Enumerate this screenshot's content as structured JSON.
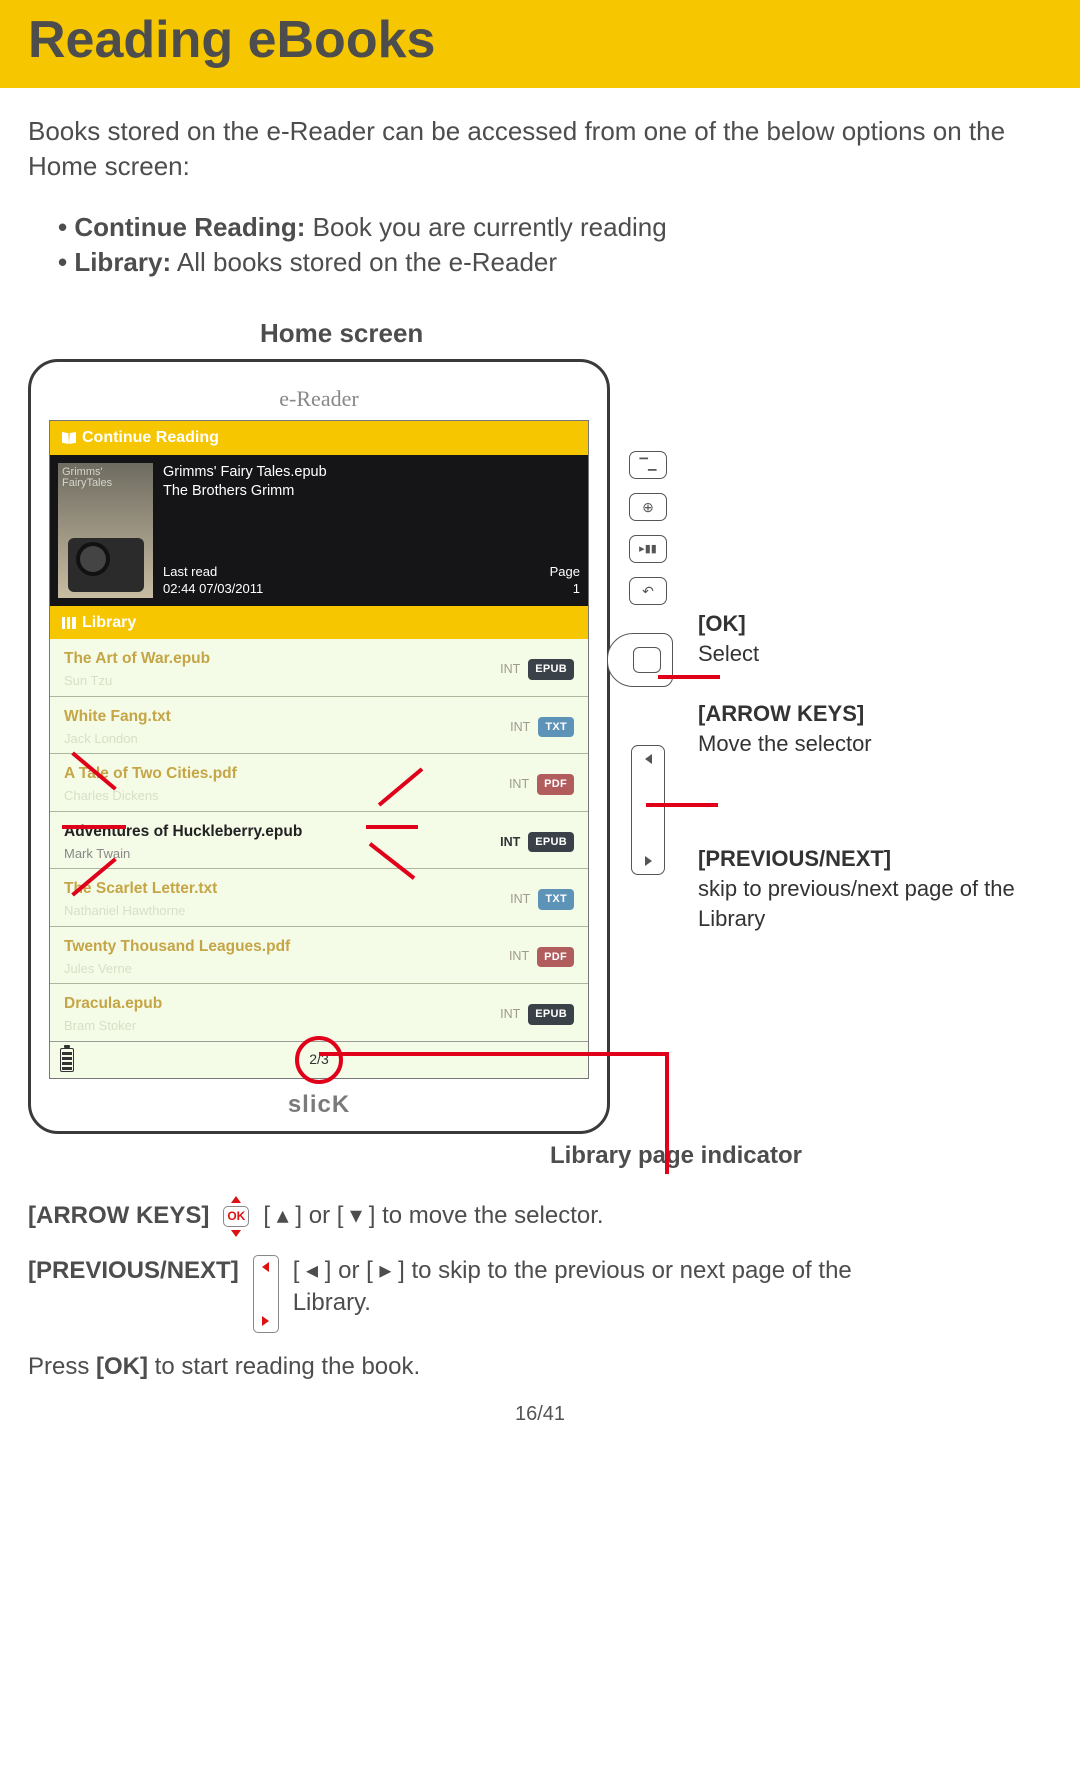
{
  "header": {
    "title": "Reading eBooks"
  },
  "intro": "Books stored on the e-Reader can be accessed from one of the below options on the Home screen:",
  "bullets": {
    "b1_label": "Continue Reading:",
    "b1_text": " Book you are currently reading",
    "b2_label": "Library:",
    "b2_text": " All books stored on the e-Reader"
  },
  "homescreen_label": "Home screen",
  "device": {
    "title": "e-Reader",
    "brand": "slicK",
    "continue_section": "Continue Reading",
    "library_section": "Library",
    "cover_title": "Grimms'\nFairyTales",
    "book_title": "Grimms' Fairy Tales.epub",
    "book_author": "The Brothers Grimm",
    "lastread_label": "Last read",
    "lastread_value": "02:44 07/03/2011",
    "page_label": "Page",
    "page_value": "1",
    "page_indicator": "2/3",
    "int_label": "INT",
    "library": [
      {
        "title": "The Art of War.epub",
        "author": "Sun Tzu",
        "fmt": "EPUB",
        "cls": "epub",
        "sel": false
      },
      {
        "title": "White Fang.txt",
        "author": "Jack London",
        "fmt": "TXT",
        "cls": "txt",
        "sel": false
      },
      {
        "title": "A Tale of Two Cities.pdf",
        "author": "Charles Dickens",
        "fmt": "PDF",
        "cls": "pdf",
        "sel": false
      },
      {
        "title": "Adventures of Huckleberry.epub",
        "author": "Mark Twain",
        "fmt": "EPUB",
        "cls": "epub",
        "sel": true
      },
      {
        "title": "The Scarlet Letter.txt",
        "author": "Nathaniel Hawthorne",
        "fmt": "TXT",
        "cls": "txt",
        "sel": false
      },
      {
        "title": "Twenty Thousand Leagues.pdf",
        "author": "Jules Verne",
        "fmt": "PDF",
        "cls": "pdf",
        "sel": false
      },
      {
        "title": "Dracula.epub",
        "author": "Bram Stoker",
        "fmt": "EPUB",
        "cls": "epub",
        "sel": false
      }
    ],
    "side_glyphs": {
      "home": "⌂",
      "zoom": "⊕",
      "play": "▸▮▮",
      "back": "↶"
    }
  },
  "callouts": {
    "ok_title": "[OK]",
    "ok_text": "Select",
    "arrow_title": "[ARROW KEYS]",
    "arrow_text": "Move the selector",
    "pn_title": "[PREVIOUS/NEXT]",
    "pn_text": "skip to previous/next page of the Library"
  },
  "indicator_label": "Library page indicator",
  "instructions": {
    "arrow_label": "[ARROW KEYS]",
    "arrow_text": "[ ▴ ] or [ ▾ ] to move the selector.",
    "pn_label": "[PREVIOUS/NEXT]",
    "pn_text_a": "[ ◂ ] or [ ▸ ] to skip to the previous or next page of the",
    "pn_text_b": "Library.",
    "press_a": "Press ",
    "press_ok": "[OK]",
    "press_b": " to start reading the book."
  },
  "page_number": "16/41"
}
